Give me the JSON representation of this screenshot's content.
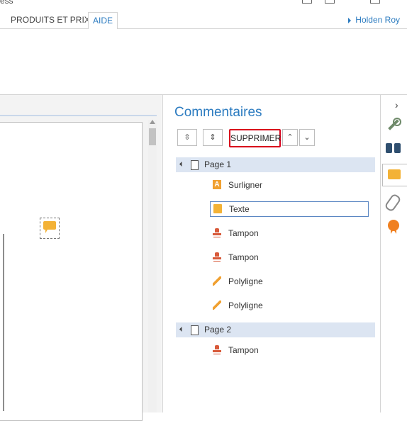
{
  "window": {
    "title_fragment": "ess"
  },
  "tabs": [
    {
      "label": "PRODUITS ET PRIX",
      "active": false
    },
    {
      "label": "AIDE",
      "active": true
    }
  ],
  "user": {
    "name": "Holden Roy"
  },
  "comments_panel": {
    "title": "Commentaires",
    "toolbar": {
      "expand_icon": "expand-all-icon",
      "collapse_icon": "collapse-all-icon",
      "delete_label": "SUPPRIMER",
      "up_glyph": "⌃",
      "down_glyph": "⌄"
    },
    "groups": [
      {
        "label": "Page 1",
        "items": [
          {
            "label": "Surligner",
            "icon": "highlight-icon"
          },
          {
            "label": "Texte",
            "icon": "text-note-icon",
            "selected": true
          },
          {
            "label": "Tampon",
            "icon": "stamp-icon"
          },
          {
            "label": "Tampon",
            "icon": "stamp-icon"
          },
          {
            "label": "Polyligne",
            "icon": "pencil-icon"
          },
          {
            "label": "Polyligne",
            "icon": "pencil-icon"
          }
        ]
      },
      {
        "label": "Page 2",
        "items": [
          {
            "label": "Tampon",
            "icon": "stamp-icon"
          }
        ]
      }
    ]
  },
  "highlight_glyph": "A",
  "rail": {
    "expand_glyph": "›",
    "icons": [
      "wrench-icon",
      "binoculars-icon",
      "comments-icon",
      "attachment-icon",
      "certificate-icon"
    ]
  },
  "colors": {
    "accent": "#2b7bc0",
    "group_bg": "#dce5f2",
    "delete_border": "#d9001b",
    "note_yellow": "#f3b236"
  }
}
